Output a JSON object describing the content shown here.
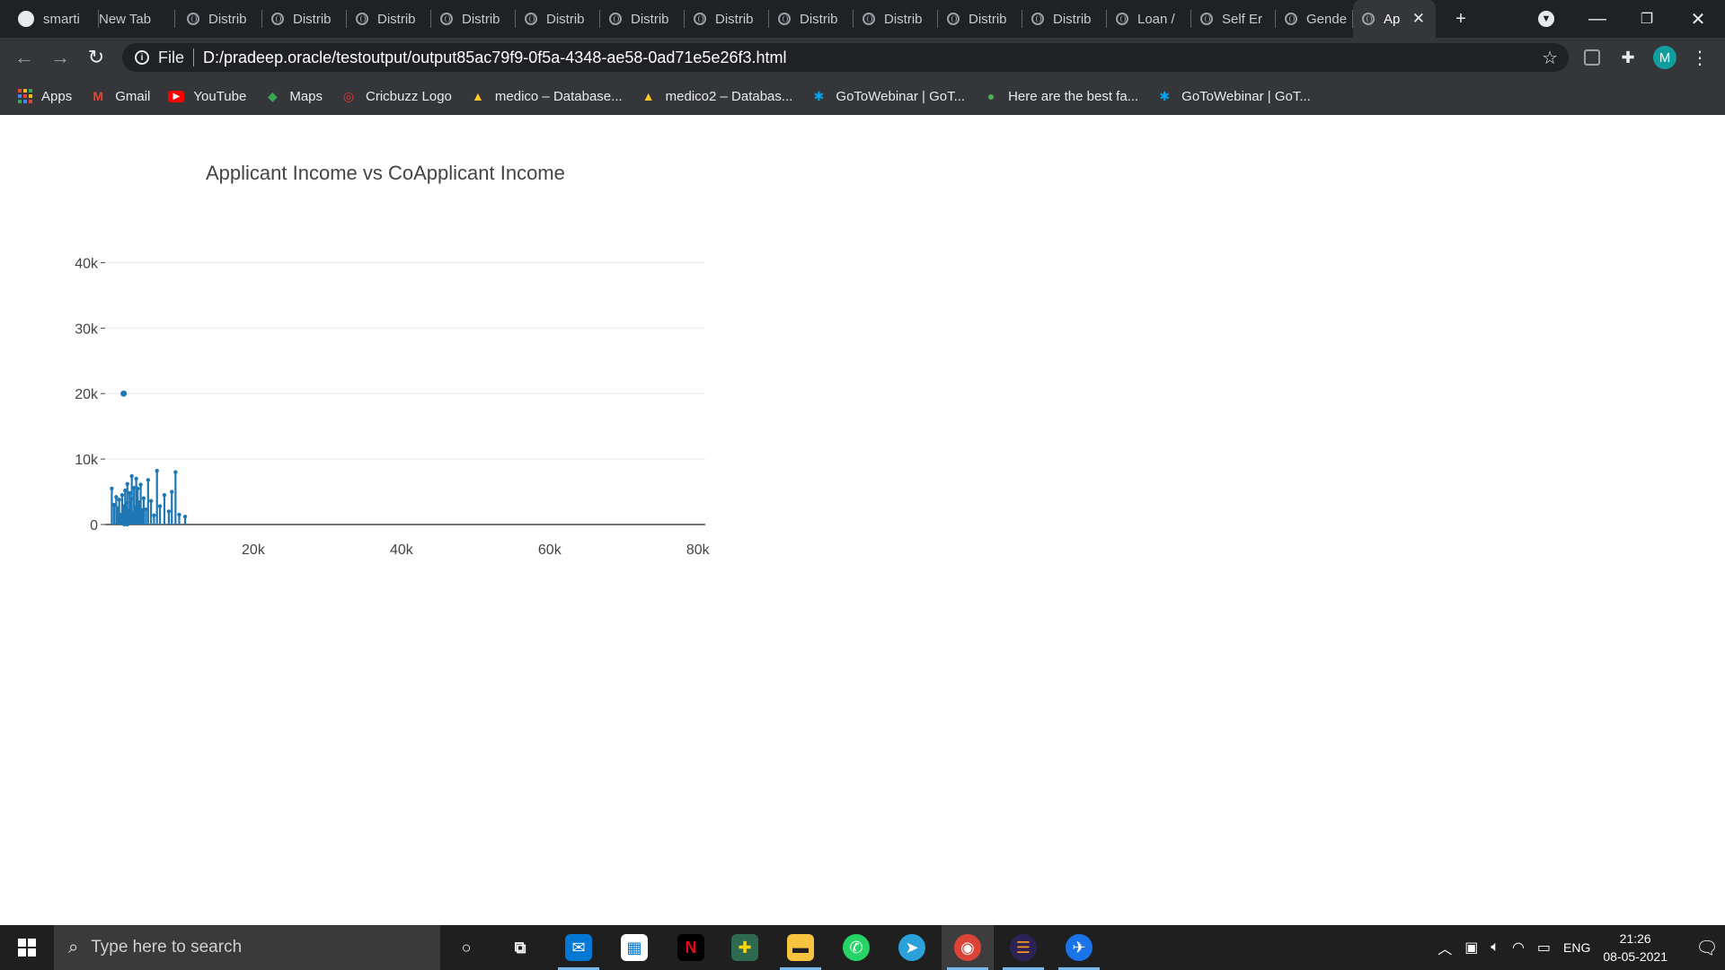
{
  "browser": {
    "tabs": [
      {
        "label": "smarti",
        "icon": "github-icon"
      },
      {
        "label": "New Tab",
        "icon": ""
      },
      {
        "label": "Distrib",
        "icon": "globe-icon"
      },
      {
        "label": "Distrib",
        "icon": "globe-icon"
      },
      {
        "label": "Distrib",
        "icon": "globe-icon"
      },
      {
        "label": "Distrib",
        "icon": "globe-icon"
      },
      {
        "label": "Distrib",
        "icon": "globe-icon"
      },
      {
        "label": "Distrib",
        "icon": "globe-icon"
      },
      {
        "label": "Distrib",
        "icon": "globe-icon"
      },
      {
        "label": "Distrib",
        "icon": "globe-icon"
      },
      {
        "label": "Distrib",
        "icon": "globe-icon"
      },
      {
        "label": "Distrib",
        "icon": "globe-icon"
      },
      {
        "label": "Distrib",
        "icon": "globe-icon"
      },
      {
        "label": "Loan /",
        "icon": "globe-icon"
      },
      {
        "label": "Self Er",
        "icon": "globe-icon"
      },
      {
        "label": "Gende",
        "icon": "globe-icon"
      },
      {
        "label": "Ap",
        "icon": "globe-icon",
        "active": true
      }
    ],
    "address": {
      "scheme_label": "File",
      "url": "D:/pradeep.oracle/testoutput/output85ac79f9-0f5a-4348-ae58-0ad71e5e26f3.html"
    },
    "profile_initial": "M",
    "bookmarks": [
      {
        "label": "Apps",
        "icon": "apps-grid-icon",
        "color": "#4285f4"
      },
      {
        "label": "Gmail",
        "icon": "gmail-icon",
        "color": "#ea4335"
      },
      {
        "label": "YouTube",
        "icon": "youtube-icon",
        "color": "#ff0000"
      },
      {
        "label": "Maps",
        "icon": "maps-icon",
        "color": "#34a853"
      },
      {
        "label": "Cricbuzz Logo",
        "icon": "cricbuzz-icon",
        "color": "#e53935"
      },
      {
        "label": "medico – Database...",
        "icon": "firebase-icon",
        "color": "#ffca28"
      },
      {
        "label": "medico2 – Databas...",
        "icon": "firebase-icon",
        "color": "#ffca28"
      },
      {
        "label": "GoToWebinar | GoT...",
        "icon": "gotowebinar-icon",
        "color": "#00a4ef"
      },
      {
        "label": "Here are the best fa...",
        "icon": "site-icon",
        "color": "#4caf50"
      },
      {
        "label": "GoToWebinar | GoT...",
        "icon": "gotowebinar-icon",
        "color": "#00a4ef"
      }
    ]
  },
  "chart_data": {
    "type": "scatter",
    "title": "Applicant Income vs CoApplicant Income",
    "xlabel": "",
    "ylabel": "",
    "xlim": [
      0,
      81000
    ],
    "ylim": [
      0,
      41700
    ],
    "x_ticks": [
      20000,
      40000,
      60000,
      80000
    ],
    "x_tick_labels": [
      "20k",
      "40k",
      "60k",
      "80k"
    ],
    "y_ticks": [
      0,
      10000,
      20000,
      30000,
      40000
    ],
    "y_tick_labels": [
      "0",
      "10k",
      "20k",
      "30k",
      "40k"
    ],
    "grid": "horizontal",
    "marker_color": "#1f77b4",
    "points": [
      {
        "x": 2500,
        "y": 20000
      },
      {
        "x": 900,
        "y": 5500
      },
      {
        "x": 1200,
        "y": 3000
      },
      {
        "x": 1500,
        "y": 4200
      },
      {
        "x": 1700,
        "y": 2500
      },
      {
        "x": 1900,
        "y": 3800
      },
      {
        "x": 2100,
        "y": 1500
      },
      {
        "x": 2300,
        "y": 4500
      },
      {
        "x": 2500,
        "y": 2800
      },
      {
        "x": 2600,
        "y": 0
      },
      {
        "x": 2700,
        "y": 5200
      },
      {
        "x": 2900,
        "y": 3300
      },
      {
        "x": 3000,
        "y": 6200
      },
      {
        "x": 3200,
        "y": 2100
      },
      {
        "x": 3300,
        "y": 4800
      },
      {
        "x": 3500,
        "y": 3900
      },
      {
        "x": 3600,
        "y": 7400
      },
      {
        "x": 3800,
        "y": 1800
      },
      {
        "x": 3900,
        "y": 5600
      },
      {
        "x": 4100,
        "y": 2600
      },
      {
        "x": 4200,
        "y": 7000
      },
      {
        "x": 4400,
        "y": 5500
      },
      {
        "x": 4600,
        "y": 3400
      },
      {
        "x": 4800,
        "y": 6100
      },
      {
        "x": 5000,
        "y": 2200
      },
      {
        "x": 5200,
        "y": 4000
      },
      {
        "x": 5500,
        "y": 2300
      },
      {
        "x": 5800,
        "y": 6800
      },
      {
        "x": 6200,
        "y": 3600
      },
      {
        "x": 6600,
        "y": 1400
      },
      {
        "x": 7000,
        "y": 8200
      },
      {
        "x": 7400,
        "y": 2800
      },
      {
        "x": 8000,
        "y": 4500
      },
      {
        "x": 8600,
        "y": 2000
      },
      {
        "x": 9000,
        "y": 5000
      },
      {
        "x": 9500,
        "y": 8000
      },
      {
        "x": 10000,
        "y": 1500
      },
      {
        "x": 10800,
        "y": 1200
      },
      {
        "x": 4800,
        "y": 2000
      },
      {
        "x": 3000,
        "y": 0
      }
    ]
  },
  "taskbar": {
    "search_placeholder": "Type here to search",
    "apps": [
      "cortana-icon",
      "task-view-icon",
      "mail-icon",
      "store-icon",
      "netflix-icon",
      "app-icon",
      "file-explorer-icon",
      "whatsapp-icon",
      "telegram-icon",
      "chrome-icon",
      "eclipse-icon",
      "app-icon"
    ],
    "language": "ENG",
    "time": "21:26",
    "date": "08-05-2021"
  }
}
